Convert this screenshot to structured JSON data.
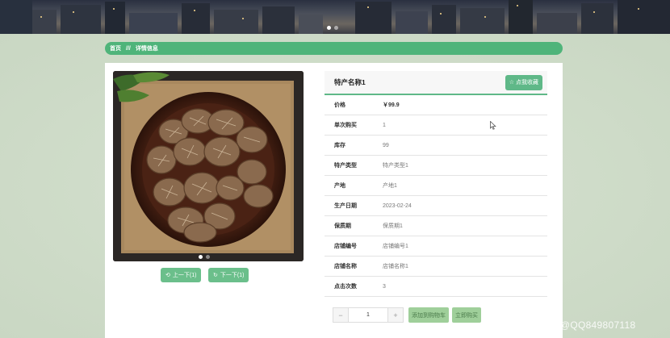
{
  "breadcrumb": {
    "home": "首页",
    "separator": "///",
    "current": "详情信息"
  },
  "product": {
    "name": "特产名称1",
    "favorite_label": "☆ 点我收藏",
    "rows": [
      {
        "key": "价格",
        "value": "￥99.9"
      },
      {
        "key": "单次购买",
        "value": "1"
      },
      {
        "key": "库存",
        "value": "99"
      },
      {
        "key": "特产类型",
        "value": "特产类型1"
      },
      {
        "key": "产地",
        "value": "产地1"
      },
      {
        "key": "生产日期",
        "value": "2023-02-24"
      },
      {
        "key": "保质期",
        "value": "保质期1"
      },
      {
        "key": "店铺编号",
        "value": "店铺编号1"
      },
      {
        "key": "店铺名称",
        "value": "店铺名称1"
      },
      {
        "key": "点击次数",
        "value": "3"
      }
    ]
  },
  "gallery": {
    "prev_label": "上一下(1)",
    "next_label": "下一下(1)"
  },
  "purchase": {
    "quantity": "1",
    "minus": "−",
    "plus": "+",
    "add_to_cart": "添加到购物车",
    "buy_now": "立即购买"
  },
  "watermark": "CSDN @QQ849807118",
  "colors": {
    "accent": "#4fb47a",
    "button": "#6bbf8b",
    "soft_button": "#9fcf9a",
    "page_bg": "#cfdcc9"
  },
  "icons": {
    "prev": "arrow-left-icon",
    "next": "refresh-icon",
    "favorite": "star-icon"
  }
}
